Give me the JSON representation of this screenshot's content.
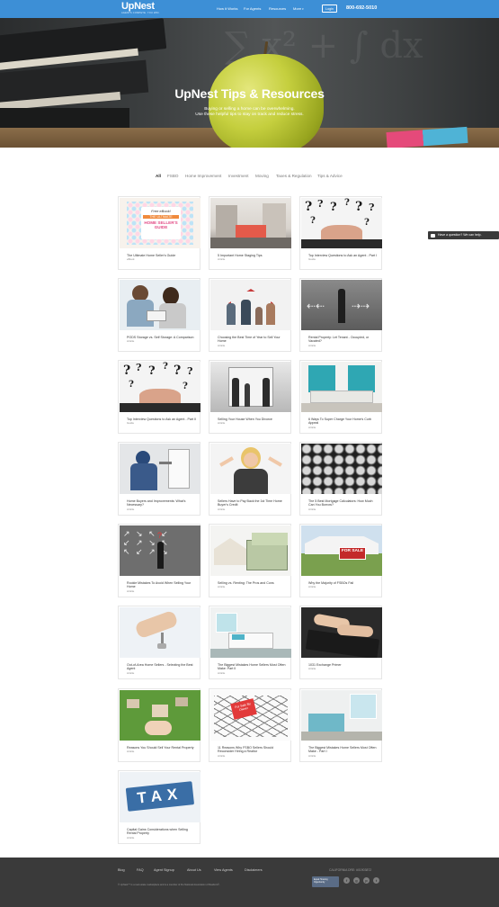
{
  "header": {
    "logo": "UpNest",
    "tagline": "AGENTS COMPETE. YOU WIN.",
    "nav": [
      {
        "label": "How it Works"
      },
      {
        "label": "For Agents"
      },
      {
        "label": "Resources"
      },
      {
        "label": "More"
      }
    ],
    "login": "Login",
    "phone": "800-692-5010"
  },
  "hero": {
    "title": "UpNest Tips & Resources",
    "subtitle_line1": "Buying or selling a home can be overwhelming.",
    "subtitle_line2": "Use these helpful tips to stay on track and reduce stress."
  },
  "filters": [
    "All",
    "FSBO",
    "Home Improvement",
    "Investment",
    "Moving",
    "Taxes & Regulation",
    "Tips & Advice"
  ],
  "cards": [
    {
      "title": "The Ultimate Home Seller's Guide",
      "type": "eBook",
      "art": "guide"
    },
    {
      "title": "5 Important Home Staging Tips",
      "type": "Article",
      "art": "kitchen"
    },
    {
      "title": "Top Interview Questions to Ask an Agent - Part I",
      "type": "Guide",
      "art": "questions"
    },
    {
      "title": "PODS Storage vs. Self Storage: A Comparison",
      "type": "Article",
      "art": "couple"
    },
    {
      "title": "Choosing the Best Time of Year to Sell Your Home",
      "type": "Article",
      "art": "family"
    },
    {
      "title": "Rental Property: Let Tenant - Occupied, or Vacated?",
      "type": "Article",
      "art": "arrows"
    },
    {
      "title": "Top Interview Questions to Ask an Agent - Part II",
      "type": "Guide",
      "art": "questions"
    },
    {
      "title": "Selling Your House When You Divorce",
      "type": "Article",
      "art": "divorce"
    },
    {
      "title": "6 Ways To Super Charge Your Home's Curb Appeal",
      "type": "Article",
      "art": "livingroom"
    },
    {
      "title": "Home Buyers and Improvements: What's Necessary?",
      "type": "Article",
      "art": "plumber"
    },
    {
      "title": "Sellers Have to Pay Back the 1st Time Home Buyer's Credit",
      "type": "Article",
      "art": "woman"
    },
    {
      "title": "The 5 Best Mortgage Calculators: How Much Can You Borrow?",
      "type": "Article",
      "art": "keys"
    },
    {
      "title": "Rookie Mistakes To Avoid When Selling Your Home",
      "type": "Article",
      "art": "chalkarrows"
    },
    {
      "title": "Selling vs. Renting: The Pros and Cons",
      "type": "Article",
      "art": "money"
    },
    {
      "title": "Why the Majority of FSBOs Fail",
      "type": "Article",
      "art": "forsale"
    },
    {
      "title": "Out-of-Area Home Sellers - Selecting the Best Agent",
      "type": "Article",
      "art": "handkeys"
    },
    {
      "title": "The Biggest Mistakes Home Sellers Most Often Make: Part II",
      "type": "Article",
      "art": "bedroom"
    },
    {
      "title": "1031 Exchange Primer",
      "type": "Article",
      "art": "typing"
    },
    {
      "title": "Reasons You Should Sell Your Rental Property",
      "type": "Article",
      "art": "grass"
    },
    {
      "title": "11 Reasons Why FSBO Sellers Should Reconsider Hiring a Realtor",
      "type": "Article",
      "art": "sketch"
    },
    {
      "title": "The Biggest Mistakes Home Sellers Most Often Make - Part I",
      "type": "Article",
      "art": "bedroom2"
    },
    {
      "title": "Capital Gains Considerations when Selling Rental Property",
      "type": "Article",
      "art": "tax"
    }
  ],
  "thumb_text": {
    "guide_line1": "Free eBook!",
    "guide_line2": "THE ULTIMATE",
    "guide_line3": "HOME SELLER'S",
    "guide_line4": "GUIDE",
    "forsale": "FOR SALE",
    "sketch_sign": "For Sale By Owner",
    "tax": "TAX"
  },
  "chat": "Have a question? We can help.",
  "footer": {
    "links": [
      "Blog",
      "FAQ",
      "Agent Signup",
      "About Us",
      "View Agents",
      "Disclaimers"
    ],
    "dre": "CALIFORNIA DRE: #01903872",
    "copyright": "© UpNest™ is a real estate marketplace and is a member of the National Association of Realtors®.",
    "badge": "Equal Housing Opportunity",
    "social": [
      "f",
      "g",
      "p",
      "t"
    ]
  },
  "colors": {
    "header_blue": "#3d8fd6",
    "footer_dark": "#3a3a3a"
  }
}
